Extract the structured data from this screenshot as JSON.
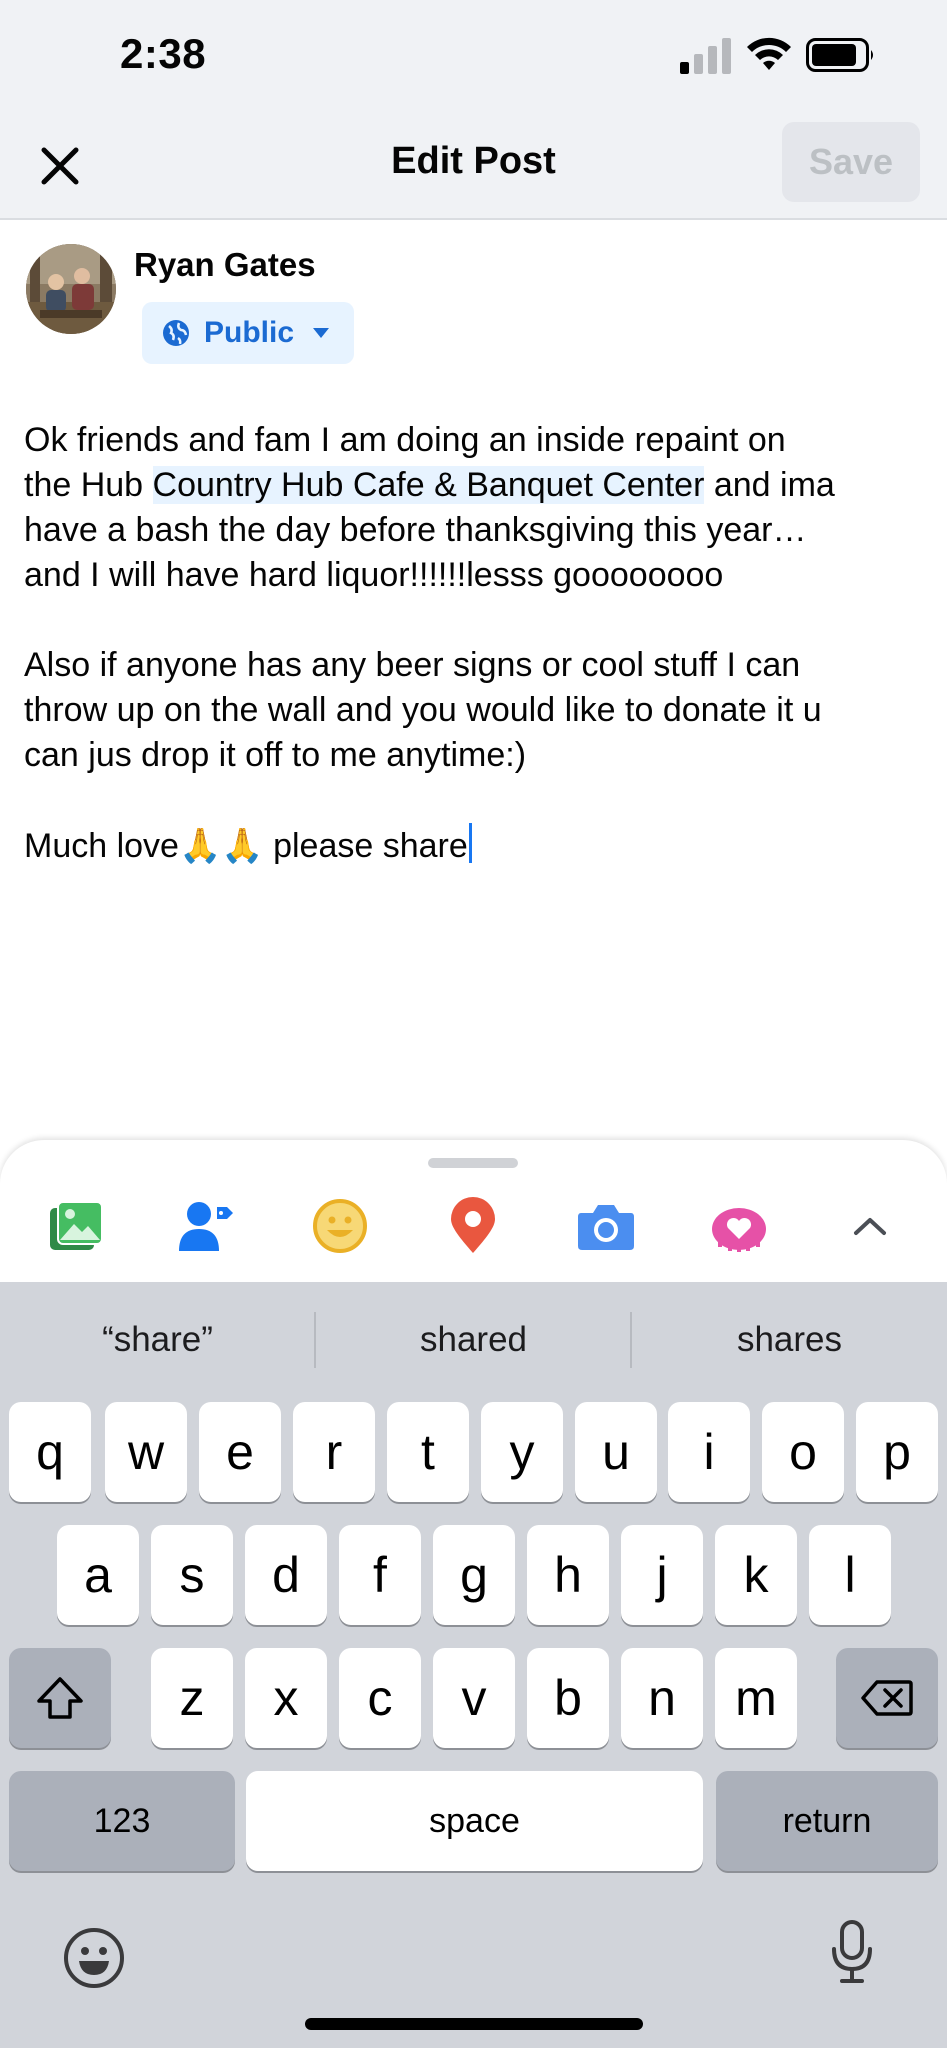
{
  "status_bar": {
    "time": "2:38"
  },
  "nav": {
    "title": "Edit Post",
    "save_label": "Save"
  },
  "post": {
    "author": "Ryan Gates",
    "audience": "Public",
    "line1": "Ok friends and fam I am doing an inside repaint on",
    "line2_before": "the Hub ",
    "mention": "Country Hub Cafe & Banquet Center",
    "line2_after": " and ima",
    "line3": "have a bash the day before thanksgiving this year…",
    "line4": "and I will have hard liquor!!!!!!lesss goooooooo",
    "para2_line1": "Also if anyone has any beer signs or cool stuff I can",
    "para2_line2": "throw up on the wall and you would like to donate it u",
    "para2_line3": "can jus drop it off to me anytime:)",
    "para3_text": "Much love🙏🙏 please share"
  },
  "toolbar": {
    "icons": [
      "photo-icon",
      "tag-people-icon",
      "feeling-icon",
      "check-in-icon",
      "camera-icon",
      "live-icon",
      "expand-icon"
    ]
  },
  "keyboard": {
    "suggestions": [
      "“share”",
      "shared",
      "shares"
    ],
    "row1": [
      "q",
      "w",
      "e",
      "r",
      "t",
      "y",
      "u",
      "i",
      "o",
      "p"
    ],
    "row2": [
      "a",
      "s",
      "d",
      "f",
      "g",
      "h",
      "j",
      "k",
      "l"
    ],
    "row3": [
      "z",
      "x",
      "c",
      "v",
      "b",
      "n",
      "m"
    ],
    "numbers_label": "123",
    "space_label": "space",
    "return_label": "return"
  },
  "colors": {
    "accent": "#1877f2",
    "header_bg": "#f0f2f5",
    "keyboard_bg": "#d1d4da"
  }
}
